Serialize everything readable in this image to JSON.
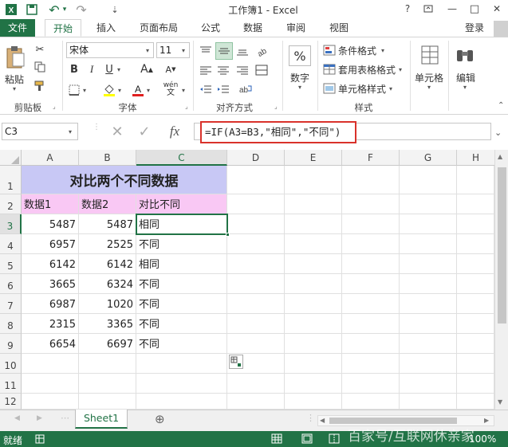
{
  "window": {
    "title": "工作簿1 - Excel",
    "help": "?",
    "restore": "⧉",
    "minimize": "—",
    "maximize": "□",
    "close": "✕"
  },
  "qat": {
    "save": "💾",
    "undo": "↶",
    "undo_arrow": "▾",
    "redo": "↷",
    "customize": "⇣"
  },
  "ribbon_tabs": [
    "文件",
    "开始",
    "插入",
    "页面布局",
    "公式",
    "数据",
    "审阅",
    "视图"
  ],
  "account": "登录",
  "ribbon": {
    "clipboard": {
      "paste": "粘贴",
      "label": "剪贴板"
    },
    "font": {
      "name": "宋体",
      "size": "11",
      "bold": "B",
      "italic": "I",
      "underline": "U",
      "grow": "A",
      "shrink": "A",
      "wen": "wén",
      "label": "字体"
    },
    "alignment": {
      "label": "对齐方式"
    },
    "number": {
      "format": "数字",
      "percent": "%"
    },
    "styles": {
      "conditional": "条件格式",
      "table": "套用表格格式",
      "cell": "单元格样式",
      "label": "样式"
    },
    "cells": {
      "label": "单元格"
    },
    "editing": {
      "label": "编辑"
    }
  },
  "formula_bar": {
    "name_box": "C3",
    "fx": "fx",
    "formula": "=IF(A3=B3,\"相同\",\"不同\")"
  },
  "sheet": {
    "columns": [
      "A",
      "B",
      "C",
      "D",
      "E",
      "F",
      "G",
      "H"
    ],
    "rows": [
      "1",
      "2",
      "3",
      "4",
      "5",
      "6",
      "7",
      "8",
      "9",
      "10",
      "11",
      "12"
    ],
    "title": "对比两个不同数据",
    "headers": [
      "数据1",
      "数据2",
      "对比不同"
    ],
    "data": [
      [
        "5487",
        "5487",
        "相同"
      ],
      [
        "6957",
        "2525",
        "不同"
      ],
      [
        "6142",
        "6142",
        "相同"
      ],
      [
        "3665",
        "6324",
        "不同"
      ],
      [
        "6987",
        "1020",
        "不同"
      ],
      [
        "2315",
        "3365",
        "不同"
      ],
      [
        "6654",
        "6697",
        "不同"
      ]
    ],
    "active_cell": "C3"
  },
  "sheet_tabs": {
    "name": "Sheet1",
    "add": "⊕",
    "prev": "◀",
    "next": "▶"
  },
  "status": {
    "ready": "就绪",
    "zoom": "100%"
  },
  "watermark": "百家号/互联网休亲家",
  "colors": {
    "excel_green": "#217346",
    "title_fill": "#c8c8f5",
    "header_fill": "#f9c8f4",
    "highlight_box": "#d9322b"
  }
}
